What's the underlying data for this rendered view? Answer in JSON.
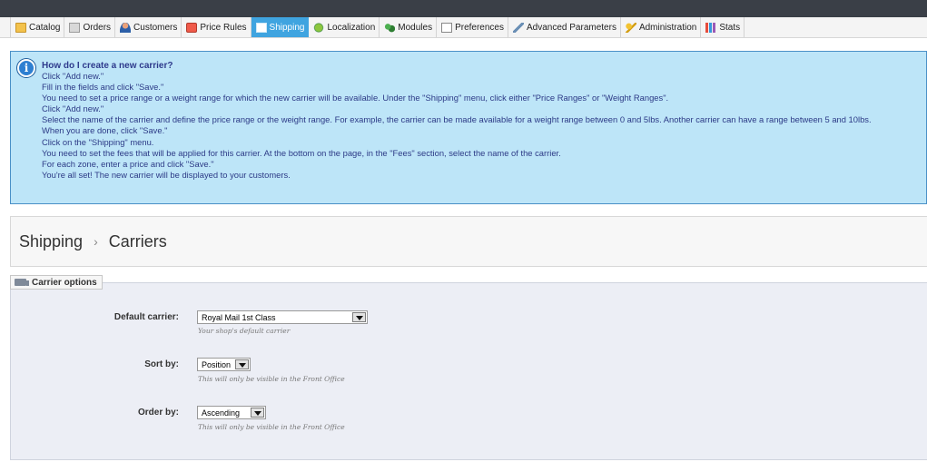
{
  "nav": {
    "tabs": [
      {
        "label": "Catalog",
        "icon": "folder-icon",
        "active": false
      },
      {
        "label": "Orders",
        "icon": "orders-icon",
        "active": false
      },
      {
        "label": "Customers",
        "icon": "customers-icon",
        "active": false
      },
      {
        "label": "Price Rules",
        "icon": "price-rules-icon",
        "active": false
      },
      {
        "label": "Shipping",
        "icon": "shipping-icon",
        "active": true
      },
      {
        "label": "Localization",
        "icon": "localization-icon",
        "active": false
      },
      {
        "label": "Modules",
        "icon": "modules-icon",
        "active": false
      },
      {
        "label": "Preferences",
        "icon": "preferences-icon",
        "active": false
      },
      {
        "label": "Advanced Parameters",
        "icon": "advanced-parameters-icon",
        "active": false
      },
      {
        "label": "Administration",
        "icon": "administration-icon",
        "active": false
      },
      {
        "label": "Stats",
        "icon": "stats-icon",
        "active": false
      }
    ],
    "active_color": "#3fa4e0"
  },
  "help": {
    "icon": "info-icon",
    "title": "How do I create a new carrier?",
    "lines": [
      "Click \"Add new.\"",
      "Fill in the fields and click \"Save.\"",
      "You need to set a price range or a weight range for which the new carrier will be available. Under the \"Shipping\" menu, click either \"Price Ranges\" or \"Weight Ranges\".",
      "Click \"Add new.\"",
      "Select the name of the carrier and define the price range or the weight range. For example, the carrier can be made available for a weight range between 0 and 5lbs. Another carrier can have a range between 5 and 10lbs.",
      "When you are done, click \"Save.\"",
      "Click on the \"Shipping\" menu.",
      "You need to set the fees that will be applied for this carrier. At the bottom on the page, in the \"Fees\" section, select the name of the carrier.",
      "For each zone, enter a price and click \"Save.\"",
      "You're all set! The new carrier will be displayed to your customers."
    ]
  },
  "breadcrumb": {
    "parent": "Shipping",
    "separator": "›",
    "current": "Carriers"
  },
  "carrier_options": {
    "legend": "Carrier options",
    "default_carrier": {
      "label": "Default carrier:",
      "value": "Royal Mail 1st Class",
      "hint": "Your shop's default carrier"
    },
    "sort_by": {
      "label": "Sort by:",
      "value": "Position",
      "hint": "This will only be visible in the Front Office"
    },
    "order_by": {
      "label": "Order by:",
      "value": "Ascending",
      "hint": "This will only be visible in the Front Office"
    }
  }
}
